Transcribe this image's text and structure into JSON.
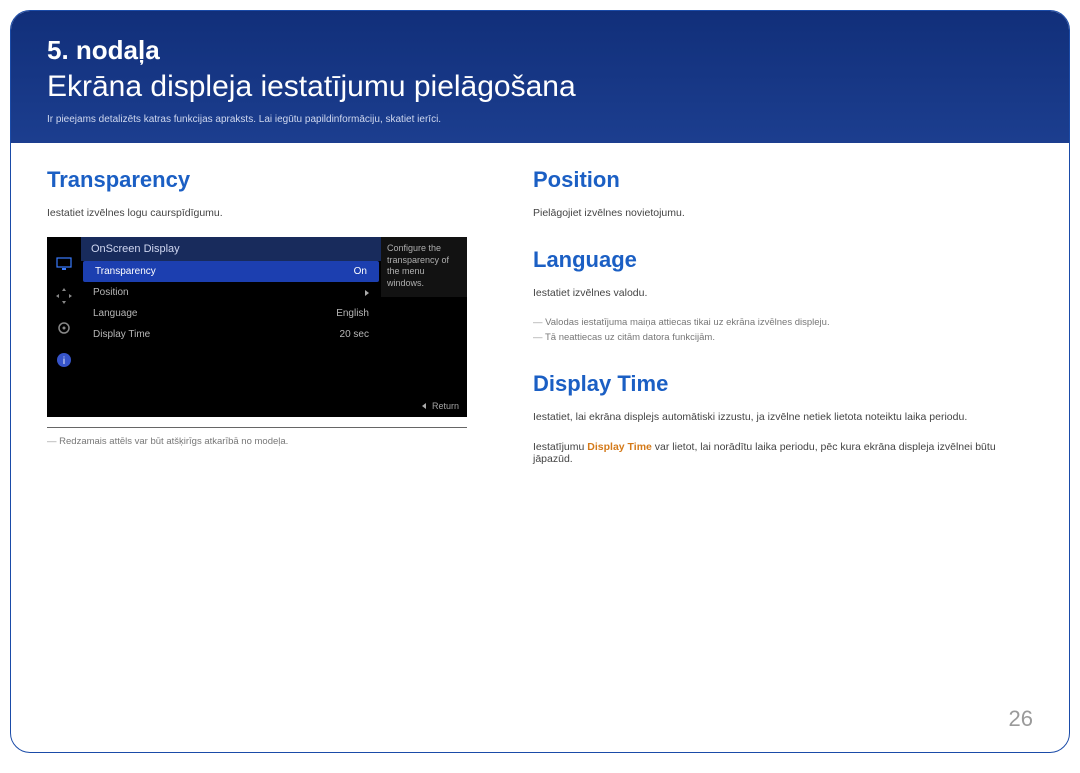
{
  "header": {
    "chapter_label": "5. nodaļa",
    "title": "Ekrāna displeja iestatījumu pielāgošana",
    "description": "Ir pieejams detalizēts katras funkcijas apraksts. Lai iegūtu papildinformāciju, skatiet ierīci."
  },
  "left": {
    "transparency": {
      "title": "Transparency",
      "desc": "Iestatiet izvēlnes logu caurspīdīgumu.",
      "image_note": "Redzamais attēls var būt atšķirīgs atkarībā no modeļa."
    },
    "osd": {
      "header": "OnScreen Display",
      "rows": [
        {
          "label": "Transparency",
          "value": "On",
          "selected": true
        },
        {
          "label": "Position",
          "value": "",
          "arrow": true
        },
        {
          "label": "Language",
          "value": "English"
        },
        {
          "label": "Display Time",
          "value": "20 sec"
        }
      ],
      "help": "Configure the transparency of the menu windows.",
      "return": "Return"
    }
  },
  "right": {
    "position": {
      "title": "Position",
      "desc": "Pielāgojiet izvēlnes novietojumu."
    },
    "language": {
      "title": "Language",
      "desc": "Iestatiet izvēlnes valodu.",
      "note1": "Valodas iestatījuma maiņa attiecas tikai uz ekrāna izvēlnes displeju.",
      "note2": "Tā neattiecas uz citām datora funkcijām."
    },
    "display_time": {
      "title": "Display Time",
      "desc1": "Iestatiet, lai ekrāna displejs automātiski izzustu, ja izvēlne netiek lietota noteiktu laika periodu.",
      "desc2_pre": "Iestatījumu ",
      "desc2_em": "Display Time",
      "desc2_post": " var lietot, lai norādītu laika periodu, pēc kura ekrāna displeja izvēlnei būtu jāpazūd."
    }
  },
  "page_number": "26"
}
